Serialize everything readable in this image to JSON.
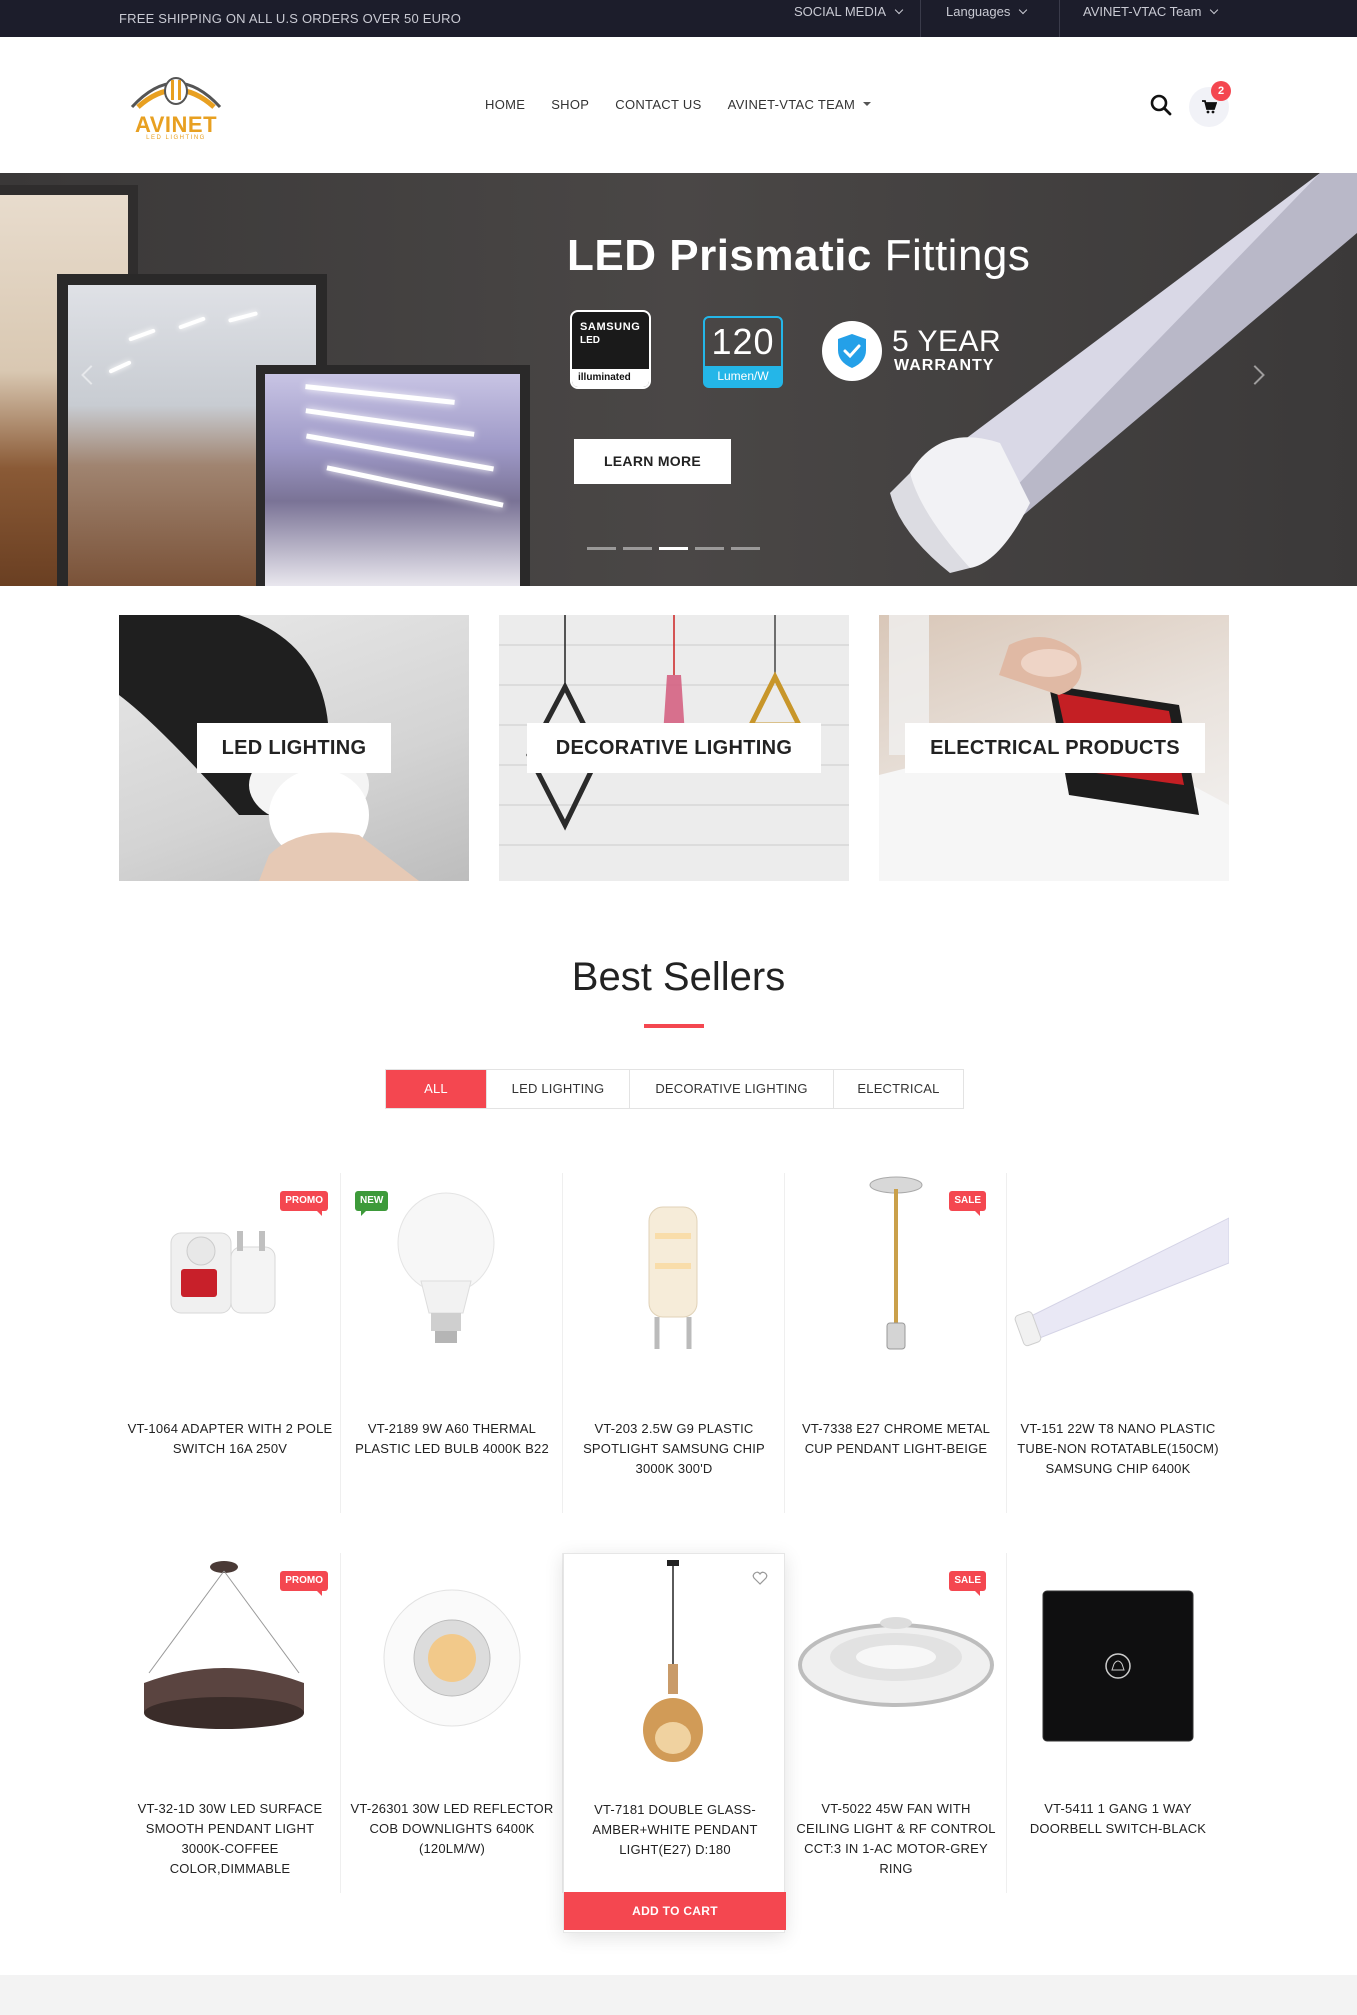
{
  "topbar": {
    "shipping": "FREE SHIPPING ON ALL U.S ORDERS OVER 50 EURO",
    "social": "SOCIAL MEDIA",
    "languages": "Languages",
    "team": "AVINET-VTAC Team"
  },
  "header": {
    "logo_text": "AVINET",
    "logo_sub": "LED LIGHTING",
    "nav": [
      "HOME",
      "SHOP",
      "CONTACT US",
      "AVINET-VTAC TEAM"
    ],
    "cart_count": "2"
  },
  "hero": {
    "title_bold": "LED Prismatic",
    "title_rest": "Fittings",
    "samsung_1": "SAMSUNG",
    "samsung_2": "LED",
    "samsung_3": "illuminated",
    "lumen_value": "120",
    "lumen_unit": "Lumen/W",
    "warranty_1": "5 YEAR",
    "warranty_2": "WARRANTY",
    "cta": "LEARN MORE",
    "slides": 5,
    "active_slide": 3
  },
  "categories": [
    {
      "label": "LED LIGHTING"
    },
    {
      "label": "DECORATIVE LIGHTING"
    },
    {
      "label": "ELECTRICAL PRODUCTS"
    }
  ],
  "best_sellers": {
    "title": "Best Sellers",
    "tabs": [
      "ALL",
      "LED LIGHTING",
      "DECORATIVE LIGHTING",
      "ELECTRICAL"
    ],
    "active_tab": "ALL",
    "add_to_cart": "ADD TO CART",
    "products": [
      {
        "name": "VT-1064 ADAPTER WITH 2 POLE SWITCH 16A 250V",
        "badge": "PROMO"
      },
      {
        "name": "VT-2189 9W A60 THERMAL PLASTIC LED BULB 4000K B22",
        "badge": "NEW"
      },
      {
        "name": "VT-203 2.5W G9 PLASTIC SPOTLIGHT SAMSUNG CHIP 3000K 300'D",
        "badge": ""
      },
      {
        "name": "VT-7338 E27 CHROME METAL CUP PENDANT LIGHT-BEIGE",
        "badge": "SALE"
      },
      {
        "name": "VT-151 22W T8 NANO PLASTIC TUBE-NON ROTATABLE(150CM) SAMSUNG CHIP 6400K",
        "badge": ""
      },
      {
        "name": "VT-32-1D 30W LED SURFACE SMOOTH PENDANT LIGHT 3000K-COFFEE COLOR,DIMMABLE",
        "badge": "PROMO"
      },
      {
        "name": "VT-26301 30W LED REFLECTOR COB DOWNLIGHTS 6400K (120LM/W)",
        "badge": ""
      },
      {
        "name": "VT-7181 DOUBLE GLASS-AMBER+WHITE PENDANT LIGHT(E27) D:180",
        "badge": ""
      },
      {
        "name": "VT-5022 45W FAN WITH CEILING LIGHT & RF CONTROL CCT:3 IN 1-AC MOTOR-GREY RING",
        "badge": "SALE"
      },
      {
        "name": "VT-5411 1 GANG 1 WAY DOORBELL SWITCH-BLACK",
        "badge": ""
      }
    ]
  },
  "colors": {
    "accent": "#f44750",
    "topbar": "#1c1d2b",
    "logo": "#e8a021",
    "new_badge": "#3d9a3a"
  }
}
